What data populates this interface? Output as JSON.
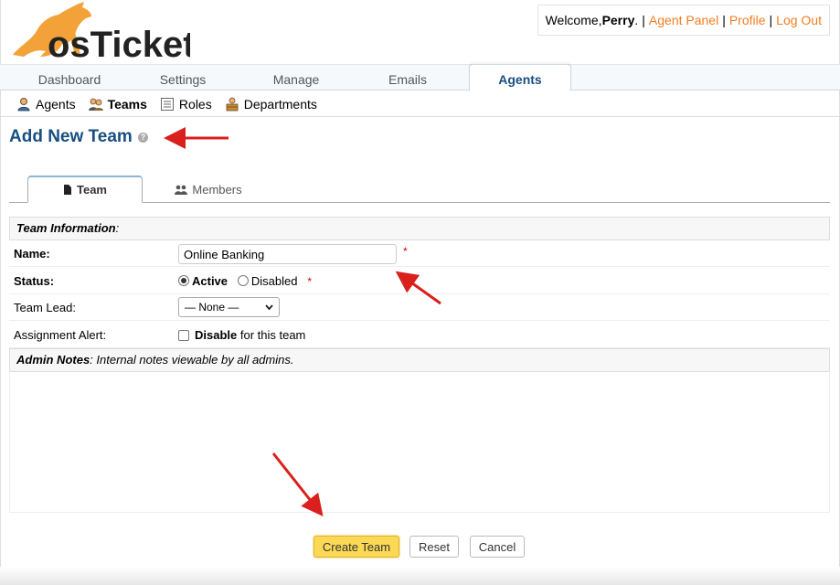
{
  "header": {
    "welcome_prefix": "Welcome, ",
    "username": "Perry",
    "welcome_suffix": ".",
    "sep1": "|",
    "agent_panel": "Agent Panel",
    "sep2": "|",
    "profile": "Profile",
    "sep3": "|",
    "logout": "Log Out",
    "logo_icon": "kangaroo-icon",
    "logo_text": "osTicket"
  },
  "nav": {
    "tabs": [
      {
        "label": "Dashboard"
      },
      {
        "label": "Settings"
      },
      {
        "label": "Manage"
      },
      {
        "label": "Emails"
      },
      {
        "label": "Agents"
      }
    ]
  },
  "subnav": {
    "items": [
      {
        "label": "Agents",
        "icon": "agent-icon"
      },
      {
        "label": "Teams",
        "icon": "teams-icon"
      },
      {
        "label": "Roles",
        "icon": "roles-icon"
      },
      {
        "label": "Departments",
        "icon": "departments-icon"
      }
    ]
  },
  "page": {
    "title": "Add New Team",
    "help_icon": "?"
  },
  "tabs": {
    "team": "Team",
    "members": "Members"
  },
  "form": {
    "team_info_header": "Team Information",
    "team_info_colon": ":",
    "name_label": "Name:",
    "name_value": "Online Banking",
    "required_mark": "*",
    "status_label": "Status:",
    "status_active": "Active",
    "status_disabled": "Disabled",
    "lead_label": "Team Lead:",
    "lead_value": "— None —",
    "alert_label": "Assignment Alert:",
    "alert_bold": "Disable",
    "alert_rest": " for this team",
    "notes_header": "Admin Notes",
    "notes_desc": ": Internal notes viewable by all admins."
  },
  "buttons": {
    "create": "Create Team",
    "reset": "Reset",
    "cancel": "Cancel"
  },
  "colors": {
    "accent_blue": "#184e81",
    "link_orange": "#f47c20",
    "arrow_red": "#d9201c",
    "create_yellow": "#fbd855"
  }
}
